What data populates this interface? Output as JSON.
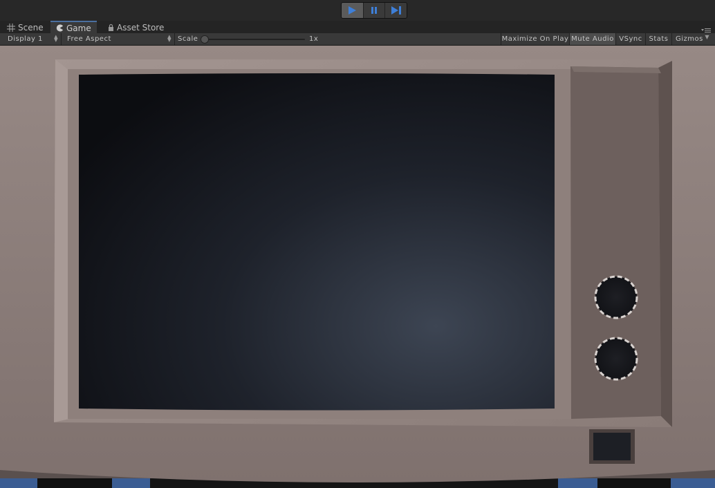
{
  "play_controls": {
    "play": "play-icon",
    "pause": "pause-icon",
    "step": "step-icon"
  },
  "tabs": [
    {
      "label": "Scene",
      "icon": "grid-icon"
    },
    {
      "label": "Game",
      "icon": "pacman-icon"
    },
    {
      "label": "Asset Store",
      "icon": "lock-icon"
    }
  ],
  "game_toolbar": {
    "display": "Display 1",
    "aspect": "Free Aspect",
    "scale_label": "Scale",
    "scale_value": "1x",
    "maximize": "Maximize On Play",
    "mute": "Mute Audio",
    "vsync": "VSync",
    "stats": "Stats",
    "gizmos": "Gizmos"
  },
  "colors": {
    "accent": "#4a6fa0",
    "cabinet": "#8d7f7b",
    "screen": "#14161c"
  }
}
